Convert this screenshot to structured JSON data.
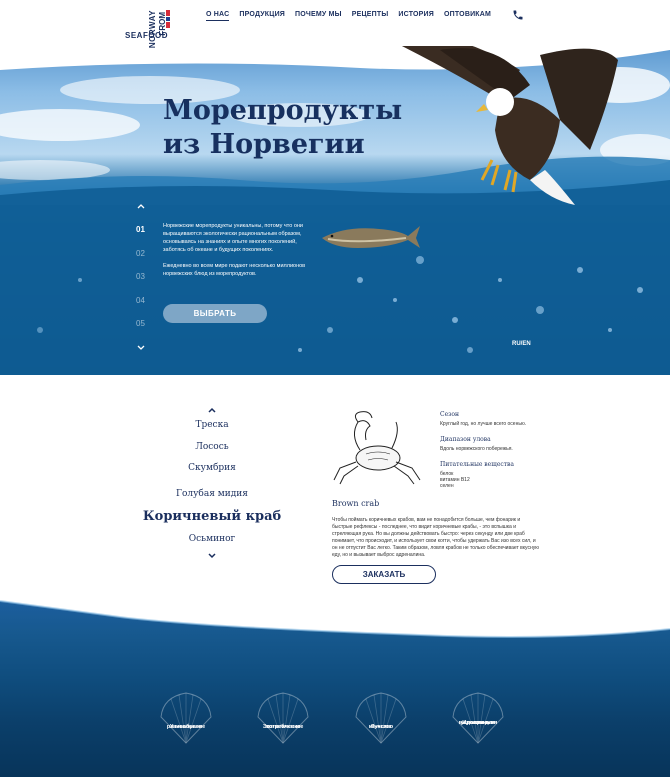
{
  "logo": {
    "seafood": "SEAFOOD",
    "from": "FROM",
    "norway": "NORWAY"
  },
  "nav": {
    "items": [
      "О НАС",
      "ПРОДУКЦИЯ",
      "ПОЧЕМУ МЫ",
      "РЕЦЕПТЫ",
      "ИСТОРИЯ",
      "ОПТОВИКАМ"
    ],
    "active": "О НАС"
  },
  "icons": [
    "phone-icon",
    "chevron-up-icon",
    "chevron-down-icon",
    "eagle-image",
    "salmon-image",
    "crab-image",
    "shell-icon"
  ],
  "hero": {
    "title_line1": "Морепродукты",
    "title_line2": "из Норвегии",
    "slides": [
      "01",
      "02",
      "03",
      "04",
      "05"
    ],
    "active_slide": "01",
    "paragraph1": "Норвежские морепродукты уникальны, потому что они выращиваются экологически рациональным образом, основываясь на знаниях и опыте многих поколений, заботясь об океане и будущих поколениях.",
    "paragraph2": "Ежедневно во всем мире подают несколько миллионов норвежских блюд из морепродуктов.",
    "button": "ВЫБРАТЬ",
    "lang": "RU/EN"
  },
  "products": {
    "list": [
      "Треска",
      "Лосось",
      "Скумбрия",
      "Голубая мидия",
      "Коричневый краб",
      "Осьминог"
    ],
    "active": "Коричневый краб",
    "name_en": "Brown crab",
    "description": "Чтобы поймать коричневых крабов, вам не понадобится больше, чем фонарик и быстрые рефлексы - последнее, что видит коричневые крабы, - это вспышка и стреляющая рука. Но вы должны действовать быстро: через секунду или две краб понимает, что происходит, и использует свои когти, чтобы удержать Вас изо всех сил, и он не отпустит Вас легко. Таким образом, ловля крабов не только обеспечивает вкусную еду, но и вызывает выброс адреналина.",
    "season_label": "Сезон",
    "season_value": "Круглый год, но лучше всего осенью.",
    "range_label": "Диапазон улова",
    "range_value": "Вдоль норвежского побережья.",
    "nutrients_label": "Питательные вещества",
    "nutrients_value1": "белок",
    "nutrients_value2": "витамин B12",
    "nutrients_value3": "селен",
    "order_button": "ЗАКАЗАТЬ"
  },
  "features": [
    {
      "line1": "Уникальное",
      "line2": "разнообразие",
      "line3": ""
    },
    {
      "line1": "Экологическое",
      "line2": "потребление",
      "line3": ""
    },
    {
      "line1": "Лучшее",
      "line2": "качество",
      "line3": ""
    },
    {
      "line1": "Идеальные",
      "line2": "условия для",
      "line3": "выращивания"
    }
  ],
  "colors": {
    "navy": "#1b2f5e",
    "ocean": "#0e5d95",
    "sky": "#8cbde6",
    "flag_red": "#d62c3a"
  }
}
